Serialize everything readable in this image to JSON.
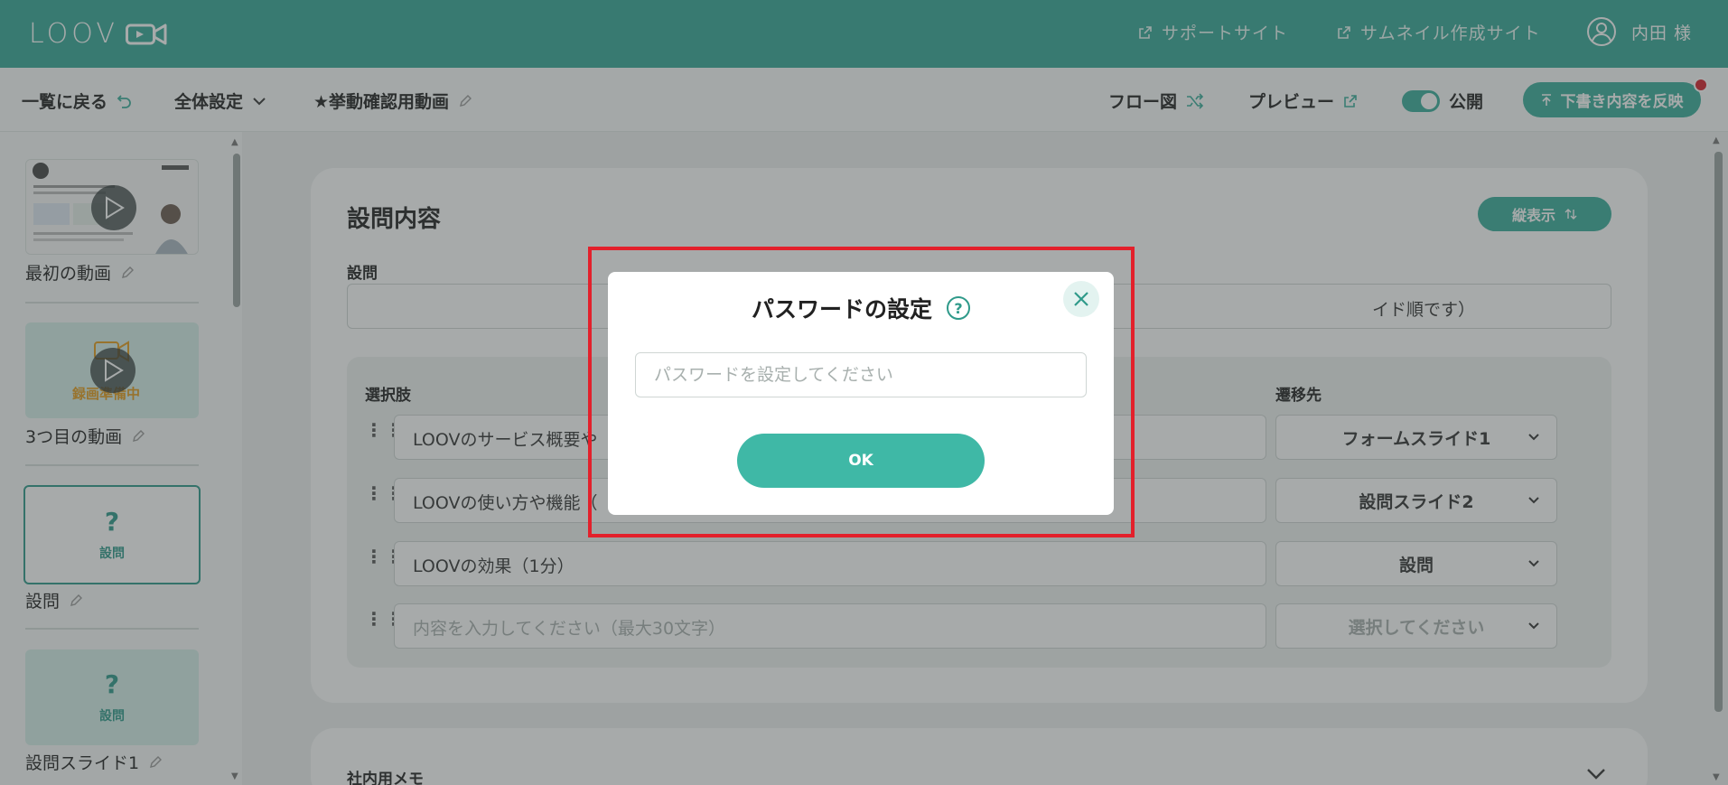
{
  "header": {
    "logo_text": "LOOV",
    "support_link": "サポートサイト",
    "thumbnail_link": "サムネイル作成サイト",
    "user_name": "内田 様"
  },
  "toolbar": {
    "back_label": "一覧に戻る",
    "global_settings": "全体設定",
    "video_name": "★挙動確認用動画",
    "flow_label": "フロー図",
    "preview_label": "プレビュー",
    "publish_label": "公開",
    "reflect_label": "下書き内容を反映"
  },
  "sidebar": {
    "items": [
      {
        "label": "最初の動画",
        "type": "video"
      },
      {
        "label": "3つ目の動画",
        "type": "recording",
        "status": "録画準備中"
      },
      {
        "label": "設問",
        "type": "question",
        "thumb_text": "設問",
        "active": true
      },
      {
        "label": "設問スライド1",
        "type": "question",
        "thumb_text": "設問"
      }
    ]
  },
  "main": {
    "title": "設問内容",
    "vertical_button": "縦表示",
    "question_label": "設問",
    "question_visible_tail": "イド順です）",
    "choices_header": "選択肢",
    "destination_header": "遷移先",
    "choices": [
      {
        "text": "LOOVのサービス概要や",
        "destination": "フォームスライド1"
      },
      {
        "text": "LOOVの使い方や機能（",
        "destination": "設問スライド2"
      },
      {
        "text": "LOOVの効果（1分）",
        "destination": "設問"
      }
    ],
    "new_choice_placeholder": "内容を入力してください（最大30文字）",
    "new_destination_placeholder": "選択してください",
    "memo_title": "社内用メモ"
  },
  "modal": {
    "title": "パスワードの設定",
    "help_icon": "?",
    "password_placeholder": "パスワードを設定してください",
    "password_value": "",
    "ok_label": "OK"
  },
  "colors": {
    "brand": "#35a897",
    "accent": "#3aae9c",
    "highlight": "#e3202b",
    "recording": "#e39b1c"
  }
}
